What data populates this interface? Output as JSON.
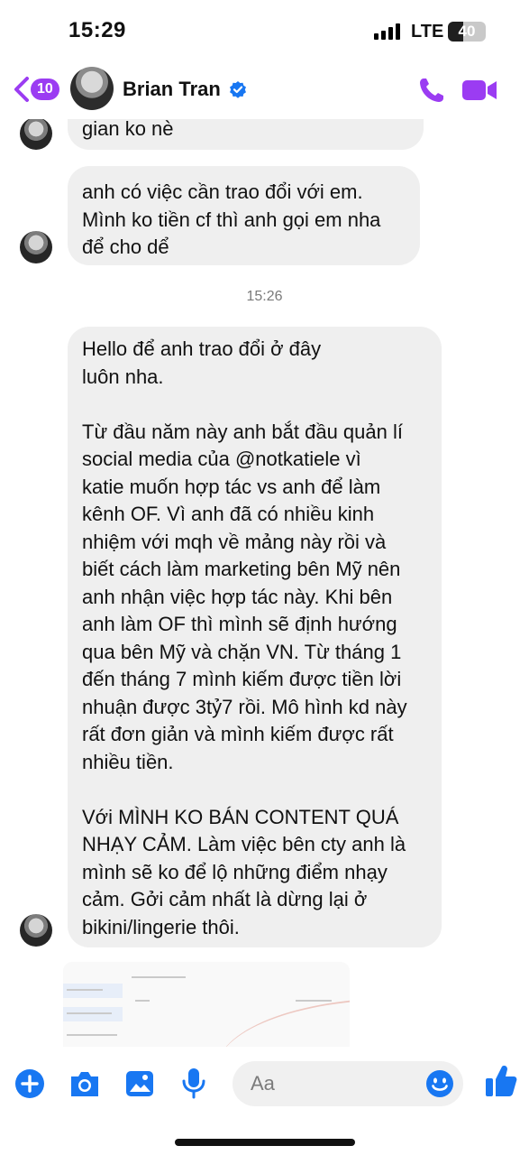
{
  "status_bar": {
    "time": "15:29",
    "network": "LTE",
    "battery": "40",
    "battery_level": 0.4
  },
  "header": {
    "back_badge": "10",
    "contact_name": "Brian Tran",
    "verified": true,
    "icons": [
      "chevron-left-icon",
      "verified-icon",
      "phone-icon",
      "video-camera-icon"
    ]
  },
  "messages": [
    {
      "text": "gian ko nè"
    },
    {
      "text": "anh có việc cần trao đổi với em.\nMình ko tiền cf thì anh gọi em nha\nđể cho dể"
    },
    {
      "text": "Hello để anh trao đổi ở đây\nluôn nha.\n\nTừ đầu năm này anh bắt đầu quản lí\nsocial media của @notkatiele vì\nkatie muốn hợp tác vs anh để làm\nkênh OF. Vì anh đã có nhiều kinh\nnhiệm với mqh về mảng này rồi và\nbiết cách làm marketing bên Mỹ nên\nanh nhận việc hợp tác này. Khi bên\nanh làm OF thì mình sẽ định hướng\nqua bên Mỹ và chặn VN. Từ tháng 1\nđến tháng 7 mình kiếm được tiền lời\nnhuận được 3tỷ7 rồi. Mô hình kd này\nrất đơn giản và mình kiếm được rất\nnhiều tiền.\n\nVới MÌNH KO BÁN CONTENT QUÁ\nNHẠY CẢM. Làm việc bên cty anh là\nmình sẽ ko để lộ những điểm nhạy\ncảm. Gởi cảm nhất là dừng lại ở\nbikini/lingerie thôi."
    }
  ],
  "timestamp": "15:26",
  "composer": {
    "placeholder": "Aa",
    "icons": [
      "plus-icon",
      "camera-icon",
      "gallery-icon",
      "microphone-icon",
      "emoji-icon",
      "thumbs-up-icon"
    ]
  },
  "colors": {
    "accent": "#9b3cf2",
    "composer_blue": "#1877f2",
    "bubble": "#efefef"
  }
}
